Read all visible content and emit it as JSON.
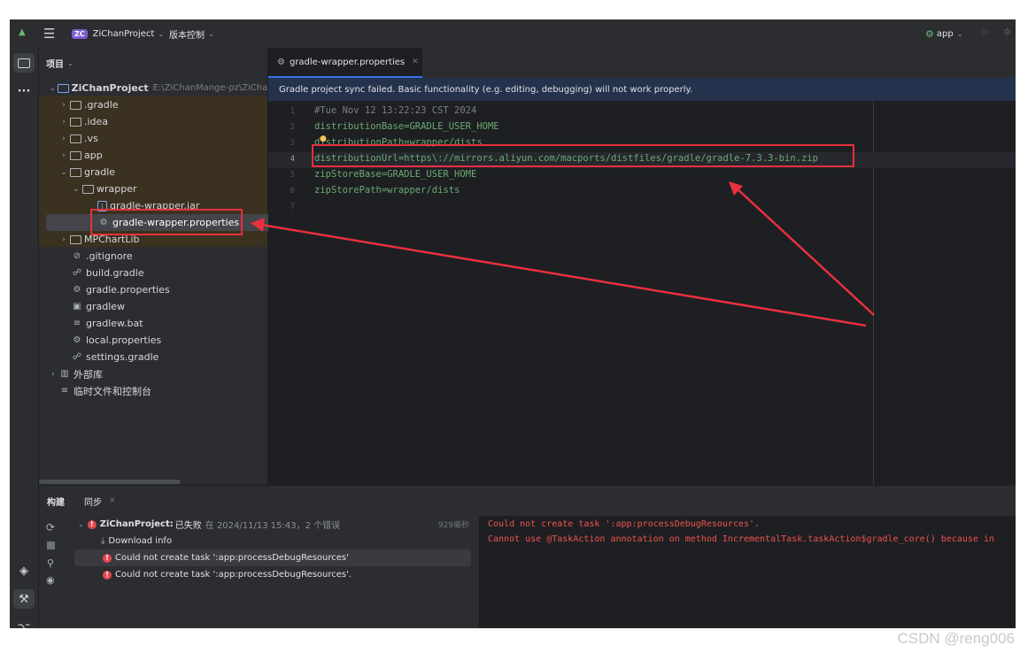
{
  "titlebar": {
    "project_badge": "ZC",
    "project_name": "ZiChanProject",
    "vcs_label": "版本控制",
    "run_config": "app"
  },
  "project_panel": {
    "title": "项目",
    "root_name": "ZiChanProject",
    "root_path": "E:\\ZiChanMange-pz\\ZiChanMan",
    "items": [
      {
        "label": ".gradle"
      },
      {
        "label": ".idea"
      },
      {
        "label": ".vs"
      },
      {
        "label": "app"
      },
      {
        "label": "gradle"
      },
      {
        "label": "wrapper"
      },
      {
        "label": "gradle-wrapper.jar"
      },
      {
        "label": "gradle-wrapper.properties"
      },
      {
        "label": "MPChartLib"
      },
      {
        "label": ".gitignore"
      },
      {
        "label": "build.gradle"
      },
      {
        "label": "gradle.properties"
      },
      {
        "label": "gradlew"
      },
      {
        "label": "gradlew.bat"
      },
      {
        "label": "local.properties"
      },
      {
        "label": "settings.gradle"
      },
      {
        "label": "外部库"
      },
      {
        "label": "临时文件和控制台"
      }
    ]
  },
  "editor": {
    "tab_label": "gradle-wrapper.properties",
    "banner": "Gradle project sync failed. Basic functionality (e.g. editing, debugging) will not work properly.",
    "lines": [
      {
        "num": "1",
        "text": "#Tue Nov 12 13:22:23 CST 2024"
      },
      {
        "num": "2",
        "text": "distributionBase=GRADLE_USER_HOME"
      },
      {
        "num": "3",
        "text": "distributionPath=wrapper/dists"
      },
      {
        "num": "4",
        "text": "distributionUrl=https\\://mirrors.aliyun.com/macports/distfiles/gradle/gradle-7.3.3-bin.zip"
      },
      {
        "num": "5",
        "text": "zipStoreBase=GRADLE_USER_HOME"
      },
      {
        "num": "6",
        "text": "zipStorePath=wrapper/dists"
      },
      {
        "num": "7",
        "text": ""
      }
    ]
  },
  "build_panel": {
    "tab_build": "构建",
    "tab_sync": "同步",
    "sync_root": "ZiChanProject:",
    "sync_status": "已失败",
    "sync_meta": "在 2024/11/13 15:43，2 个错误",
    "sync_time": "929毫秒",
    "download_info": "Download info",
    "error1": "Could not create task ':app:processDebugResources'",
    "error2": "Could not create task ':app:processDebugResources'.",
    "console_line1": "Could not create task ':app:processDebugResources'.",
    "console_line2": "Cannot use @TaskAction annotation on method IncrementalTask.taskAction$gradle_core() because in"
  },
  "watermark": "CSDN @reng006",
  "colors": {
    "accent": "#3574f0",
    "error": "#e5484d",
    "highlight_box": "#e8303e",
    "arrow": "#e8303e",
    "code_string": "#6aab73",
    "code_comment": "#7a7e85"
  }
}
